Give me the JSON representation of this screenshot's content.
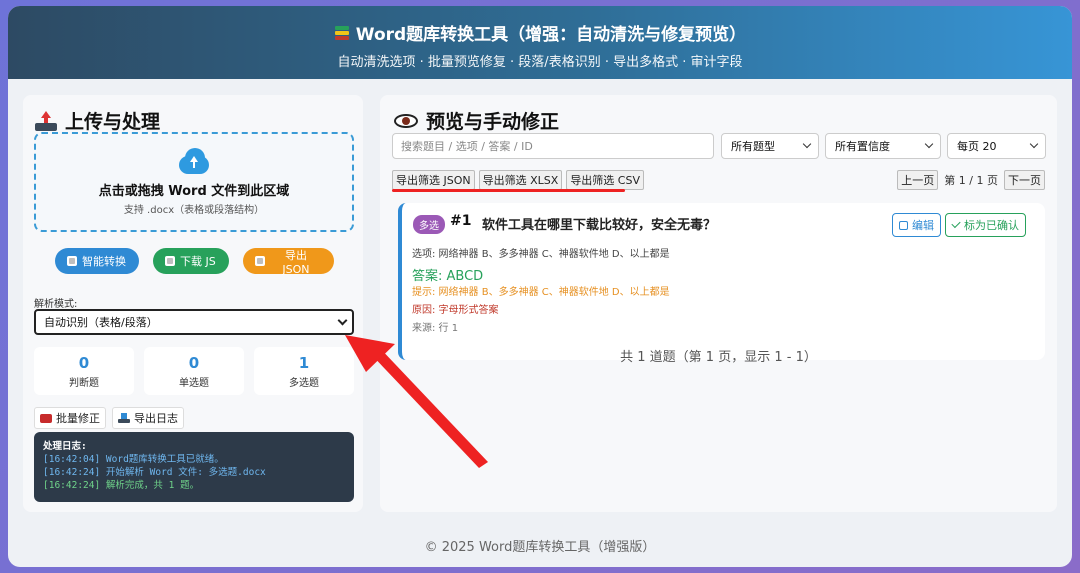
{
  "header": {
    "title": "Word题库转换工具（增强：自动清洗与修复预览）",
    "subtitle": "自动清洗选项 · 批量预览修复 · 段落/表格识别 · 导出多格式 · 审计字段"
  },
  "left": {
    "title": "上传与处理",
    "dropzone": {
      "main": "点击或拖拽 Word 文件到此区域",
      "hint": "支持 .docx（表格或段落结构）"
    },
    "buttons": {
      "convert": "智能转换",
      "download_js": "下载 JS",
      "export_json": "导出 JSON"
    },
    "mode_label": "解析模式:",
    "mode_value": "自动识别（表格/段落）",
    "stats": [
      {
        "num": "0",
        "label": "判断题"
      },
      {
        "num": "0",
        "label": "单选题"
      },
      {
        "num": "1",
        "label": "多选题"
      }
    ],
    "tools": {
      "batch_fix": "批量修正",
      "export_log": "导出日志"
    },
    "log": {
      "head": "处理日志:",
      "lines": [
        "[16:42:04] Word题库转换工具已就绪。",
        "[16:42:24] 开始解析 Word 文件: 多选题.docx",
        "[16:42:24] 解析完成，共 1 题。"
      ]
    }
  },
  "right": {
    "title": "预览与手动修正",
    "search_placeholder": "搜索题目 / 选项 / 答案 / ID",
    "filters": {
      "type": "所有题型",
      "confidence": "所有置信度",
      "per_page": "每页 20"
    },
    "exports": {
      "json": "导出筛选 JSON",
      "xlsx": "导出筛选 XLSX",
      "csv": "导出筛选 CSV"
    },
    "pager": {
      "prev": "上一页",
      "info": "第 1 / 1 页",
      "next": "下一页"
    },
    "card": {
      "badge": "多选",
      "id": "#1",
      "question": "软件工具在哪里下载比较好，安全无毒？",
      "edit": "编辑",
      "confirm": "标为已确认",
      "options": "选项: 网络神器 B、多多神器 C、神器软件地 D、以上都是",
      "answer": "答案: ABCD",
      "tip": "提示: 网络神器 B、多多神器 C、神器软件地 D、以上都是",
      "reason": "原因: 字母形式答案",
      "source": "来源: 行 1"
    },
    "summary": "共 1 道题（第 1 页，显示 1 - 1）"
  },
  "footer": "© 2025 Word题库转换工具（增强版）",
  "colors": {
    "accent_blue": "#2f8ad4",
    "green": "#27a15b",
    "orange": "#f0981a",
    "annotation_red": "#ee2222"
  }
}
